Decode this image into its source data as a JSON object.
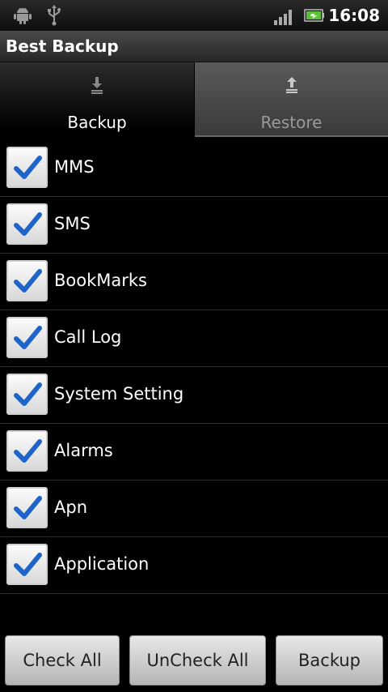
{
  "status_bar": {
    "time": "16:08",
    "icons": [
      "android-icon",
      "usb-icon",
      "signal-icon",
      "battery-icon"
    ]
  },
  "app": {
    "title": "Best Backup"
  },
  "tabs": [
    {
      "label": "Backup",
      "icon": "download-icon",
      "selected": true
    },
    {
      "label": "Restore",
      "icon": "upload-icon",
      "selected": false
    }
  ],
  "items": [
    {
      "label": "MMS",
      "checked": true
    },
    {
      "label": "SMS",
      "checked": true
    },
    {
      "label": "BookMarks",
      "checked": true
    },
    {
      "label": "Call Log",
      "checked": true
    },
    {
      "label": "System Setting",
      "checked": true
    },
    {
      "label": "Alarms",
      "checked": true
    },
    {
      "label": "Apn",
      "checked": true
    },
    {
      "label": "Application",
      "checked": true
    }
  ],
  "buttons": {
    "check_all": "Check All",
    "uncheck_all": "UnCheck All",
    "backup": "Backup"
  },
  "colors": {
    "check_mark": "#1f64c8",
    "background": "#000000"
  }
}
